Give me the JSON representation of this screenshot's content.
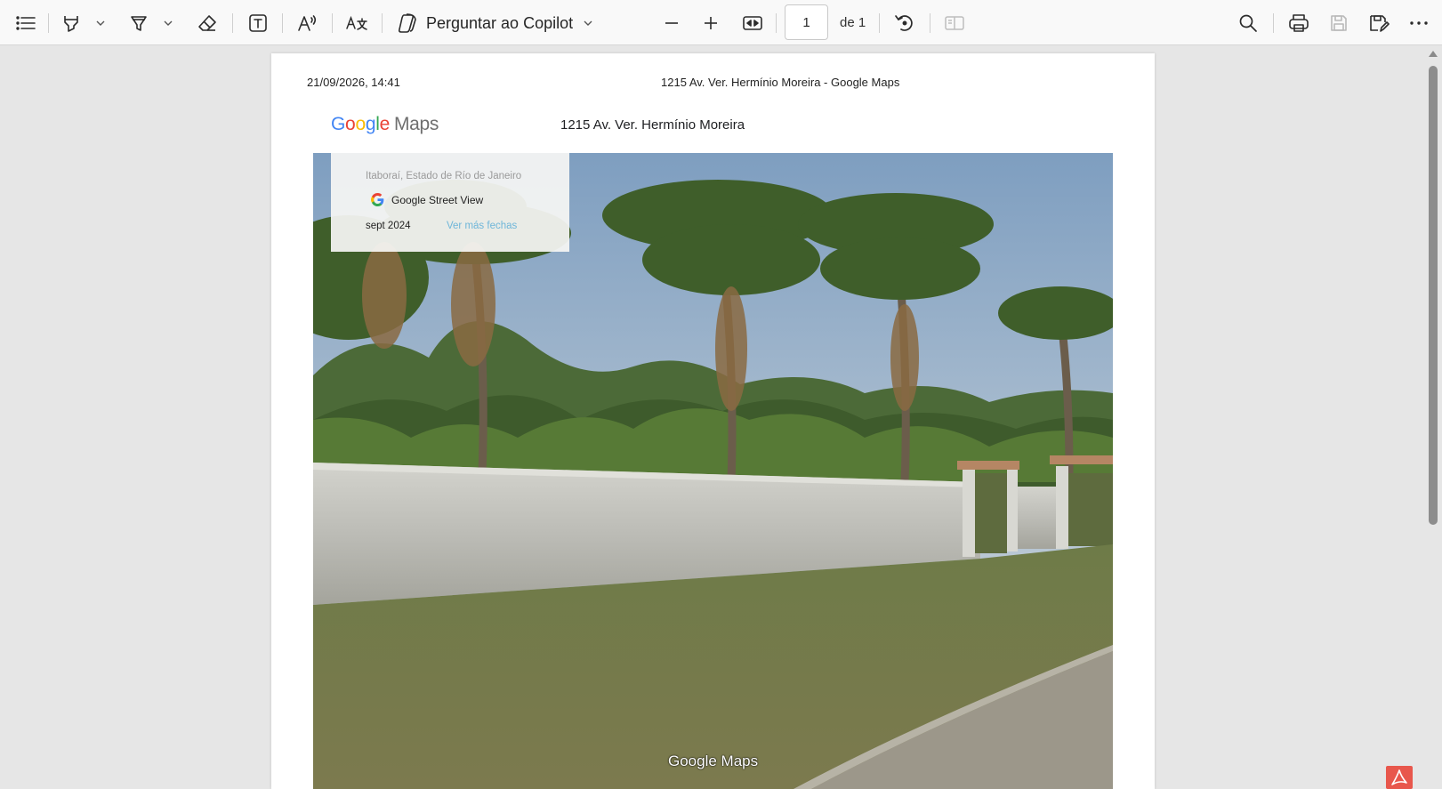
{
  "toolbar": {
    "copilot_label": "Perguntar ao Copilot",
    "page_current": "1",
    "page_total": "de 1",
    "icons": [
      "contents-icon",
      "highlight-icon",
      "draw-icon",
      "erase-icon",
      "text-box-icon",
      "read-aloud-icon",
      "translate-icon",
      "copilot-icon",
      "zoom-out-icon",
      "zoom-in-icon",
      "fit-width-icon",
      "rotate-icon",
      "page-view-icon",
      "search-icon",
      "print-icon",
      "save-icon",
      "save-as-icon",
      "more-icon"
    ]
  },
  "pdf": {
    "header_date": "21/09/2026, 14:41",
    "header_title": "1215 Av. Ver. Hermínio Moreira - Google Maps",
    "logo": {
      "letters": [
        "G",
        "o",
        "o",
        "g",
        "l",
        "e"
      ],
      "product": "Maps"
    },
    "address_title": "1215 Av. Ver. Hermínio Moreira",
    "info_card": {
      "location": "Itaboraí, Estado de Río de Janeiro",
      "service": "Google Street View",
      "date": "sept 2024",
      "more_dates": "Ver más fechas"
    },
    "watermark": "Google Maps"
  },
  "colors": {
    "google_blue": "#4285f4",
    "google_red": "#ea4335",
    "google_yellow": "#fbbc05",
    "google_green": "#34a853",
    "link": "#6fb6d9",
    "acrobat_red": "#e8574c"
  }
}
